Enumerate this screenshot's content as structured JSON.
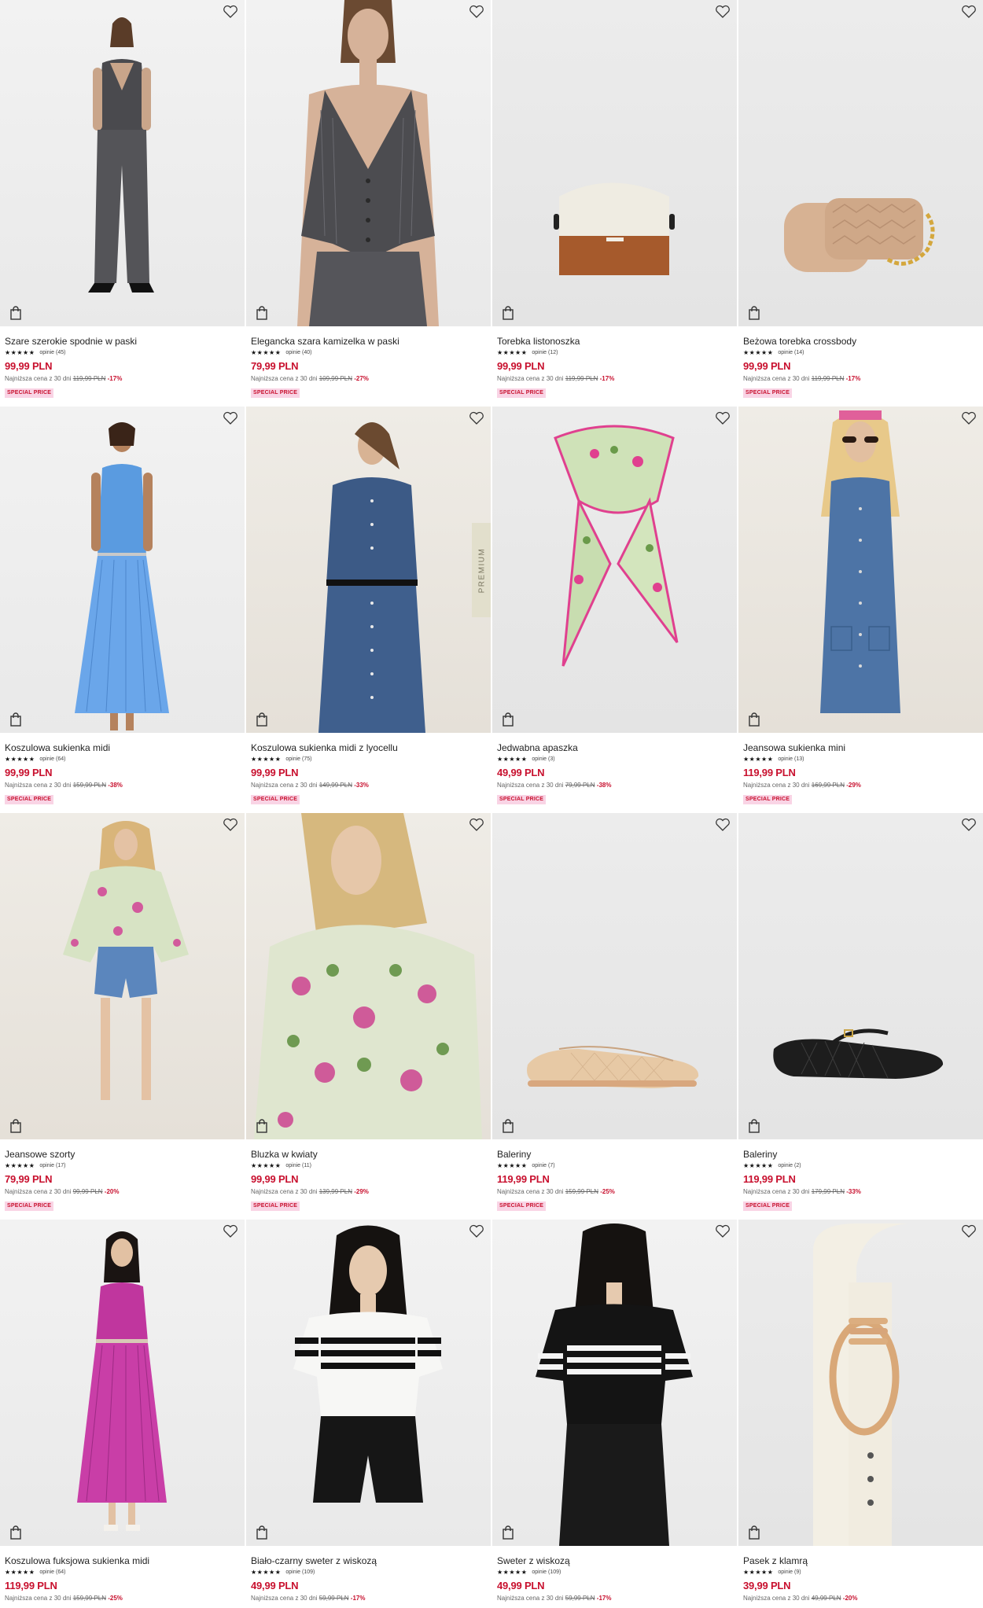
{
  "labels": {
    "lowest_prefix": "Najniższa cena z 30 dni",
    "premium": "PREMIUM"
  },
  "colors": {
    "price": "#c8102e",
    "badge_bg": "#f9d4e5"
  },
  "products": [
    {
      "name": "Szare szerokie spodnie w paski",
      "stars": "★★★★★",
      "reviews": "opinie (45)",
      "price": "99,99 PLN",
      "old_price": "119,99 PLN",
      "discount": "-17%",
      "badge": "SPECIAL PRICE",
      "image": "woman-grey-pinstripe-suit"
    },
    {
      "name": "Elegancka szara kamizelka w paski",
      "stars": "★★★★★",
      "reviews": "opinie (40)",
      "price": "79,99 PLN",
      "old_price": "109,99 PLN",
      "discount": "-27%",
      "badge": "SPECIAL PRICE",
      "image": "grey-pinstripe-vest"
    },
    {
      "name": "Torebka listonoszka",
      "stars": "★★★★★",
      "reviews": "opinie (12)",
      "price": "99,99 PLN",
      "old_price": "119,99 PLN",
      "discount": "-17%",
      "badge": "SPECIAL PRICE",
      "image": "cream-brown-crossbody-bag"
    },
    {
      "name": "Beżowa torebka crossbody",
      "stars": "★★★★★",
      "reviews": "opinie (14)",
      "price": "99,99 PLN",
      "old_price": "119,99 PLN",
      "discount": "-17%",
      "badge": "SPECIAL PRICE",
      "image": "beige-quilted-bag-chain"
    },
    {
      "name": "Koszulowa sukienka midi",
      "stars": "★★★★★",
      "reviews": "opinie (64)",
      "price": "99,99 PLN",
      "old_price": "159,99 PLN",
      "discount": "-38%",
      "badge": "SPECIAL PRICE",
      "image": "blue-pleated-dress"
    },
    {
      "name": "Koszulowa sukienka midi z lyocellu",
      "stars": "★★★★★",
      "reviews": "opinie (75)",
      "price": "99,99 PLN",
      "old_price": "149,99 PLN",
      "discount": "-33%",
      "badge": "SPECIAL PRICE",
      "image": "navy-shirt-dress",
      "premium": true
    },
    {
      "name": "Jedwabna apaszka",
      "stars": "★★★★★",
      "reviews": "opinie (3)",
      "price": "49,99 PLN",
      "old_price": "79,99 PLN",
      "discount": "-38%",
      "badge": "SPECIAL PRICE",
      "image": "floral-silk-scarf"
    },
    {
      "name": "Jeansowa sukienka mini",
      "stars": "★★★★★",
      "reviews": "opinie (13)",
      "price": "119,99 PLN",
      "old_price": "169,99 PLN",
      "discount": "-29%",
      "badge": "SPECIAL PRICE",
      "image": "denim-mini-dress"
    },
    {
      "name": "Jeansowe szorty",
      "stars": "★★★★★",
      "reviews": "opinie (17)",
      "price": "79,99 PLN",
      "old_price": "99,99 PLN",
      "discount": "-20%",
      "badge": "SPECIAL PRICE",
      "image": "denim-shorts-floral-top"
    },
    {
      "name": "Bluzka w kwiaty",
      "stars": "★★★★★",
      "reviews": "opinie (11)",
      "price": "99,99 PLN",
      "old_price": "139,99 PLN",
      "discount": "-29%",
      "badge": "SPECIAL PRICE",
      "image": "floral-blouse"
    },
    {
      "name": "Baleriny",
      "stars": "★★★★★",
      "reviews": "opinie (7)",
      "price": "119,99 PLN",
      "old_price": "159,99 PLN",
      "discount": "-25%",
      "badge": "SPECIAL PRICE",
      "image": "beige-mesh-flats"
    },
    {
      "name": "Baleriny",
      "stars": "★★★★★",
      "reviews": "opinie (2)",
      "price": "119,99 PLN",
      "old_price": "179,99 PLN",
      "discount": "-33%",
      "badge": "SPECIAL PRICE",
      "image": "black-woven-flats"
    },
    {
      "name": "Koszulowa fuksjowa sukienka midi",
      "stars": "★★★★★",
      "reviews": "opinie (64)",
      "price": "119,99 PLN",
      "old_price": "159,99 PLN",
      "discount": "-25%",
      "badge": "",
      "image": "fuchsia-pleated-dress"
    },
    {
      "name": "Biało-czarny sweter z wiskozą",
      "stars": "★★★★★",
      "reviews": "opinie (109)",
      "price": "49,99 PLN",
      "old_price": "59,99 PLN",
      "discount": "-17%",
      "badge": "",
      "image": "white-striped-sweater"
    },
    {
      "name": "Sweter z wiskozą",
      "stars": "★★★★★",
      "reviews": "opinie (109)",
      "price": "49,99 PLN",
      "old_price": "59,99 PLN",
      "discount": "-17%",
      "badge": "",
      "image": "black-striped-sweater"
    },
    {
      "name": "Pasek z klamrą",
      "stars": "★★★★★",
      "reviews": "opinie (9)",
      "price": "39,99 PLN",
      "old_price": "49,99 PLN",
      "discount": "-20%",
      "badge": "",
      "image": "cream-belt-gold-buckle"
    }
  ]
}
